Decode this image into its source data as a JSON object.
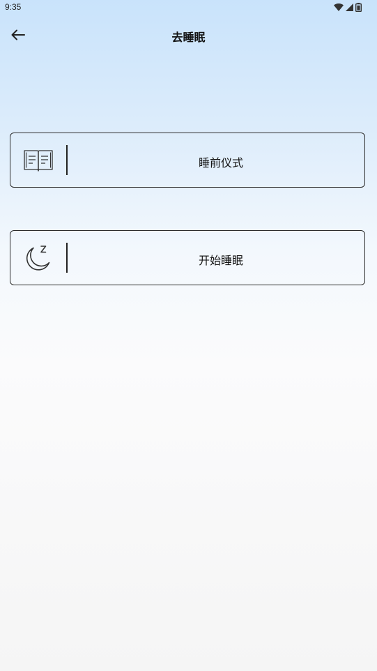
{
  "status_bar": {
    "time": "9:35",
    "icons": [
      "wifi-icon",
      "signal-icon",
      "battery-icon"
    ]
  },
  "app_bar": {
    "back_icon": "arrow-left-icon",
    "title": "去睡眠"
  },
  "cards": [
    {
      "icon": "book-icon",
      "label": "睡前仪式"
    },
    {
      "icon": "moon-sleep-icon",
      "label": "开始睡眠"
    }
  ],
  "colors": {
    "gradient_top": "#c9e3fb",
    "gradient_bottom": "#f5f5f5",
    "border": "#2b2b2b"
  }
}
